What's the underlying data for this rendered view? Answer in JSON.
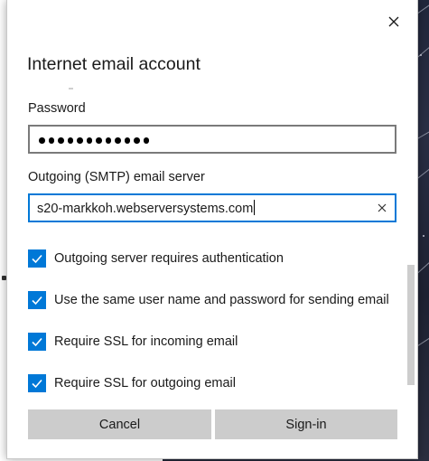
{
  "dialog": {
    "title": "Internet email account",
    "close_icon": "close-icon"
  },
  "password": {
    "label": "Password",
    "masked_length": 12
  },
  "smtp": {
    "label": "Outgoing (SMTP) email server",
    "value": "s20-markkoh.webserversystems.com",
    "clear_icon": "clear-x-icon"
  },
  "options": [
    {
      "label": "Outgoing server requires authentication",
      "checked": true
    },
    {
      "label": "Use the same user name and password for sending email",
      "checked": true
    },
    {
      "label": "Require SSL for incoming email",
      "checked": true
    },
    {
      "label": "Require SSL for outgoing email",
      "checked": true
    }
  ],
  "buttons": {
    "cancel": "Cancel",
    "signin": "Sign-in"
  },
  "colors": {
    "accent": "#0078d7",
    "button_bg": "#cccccc"
  }
}
